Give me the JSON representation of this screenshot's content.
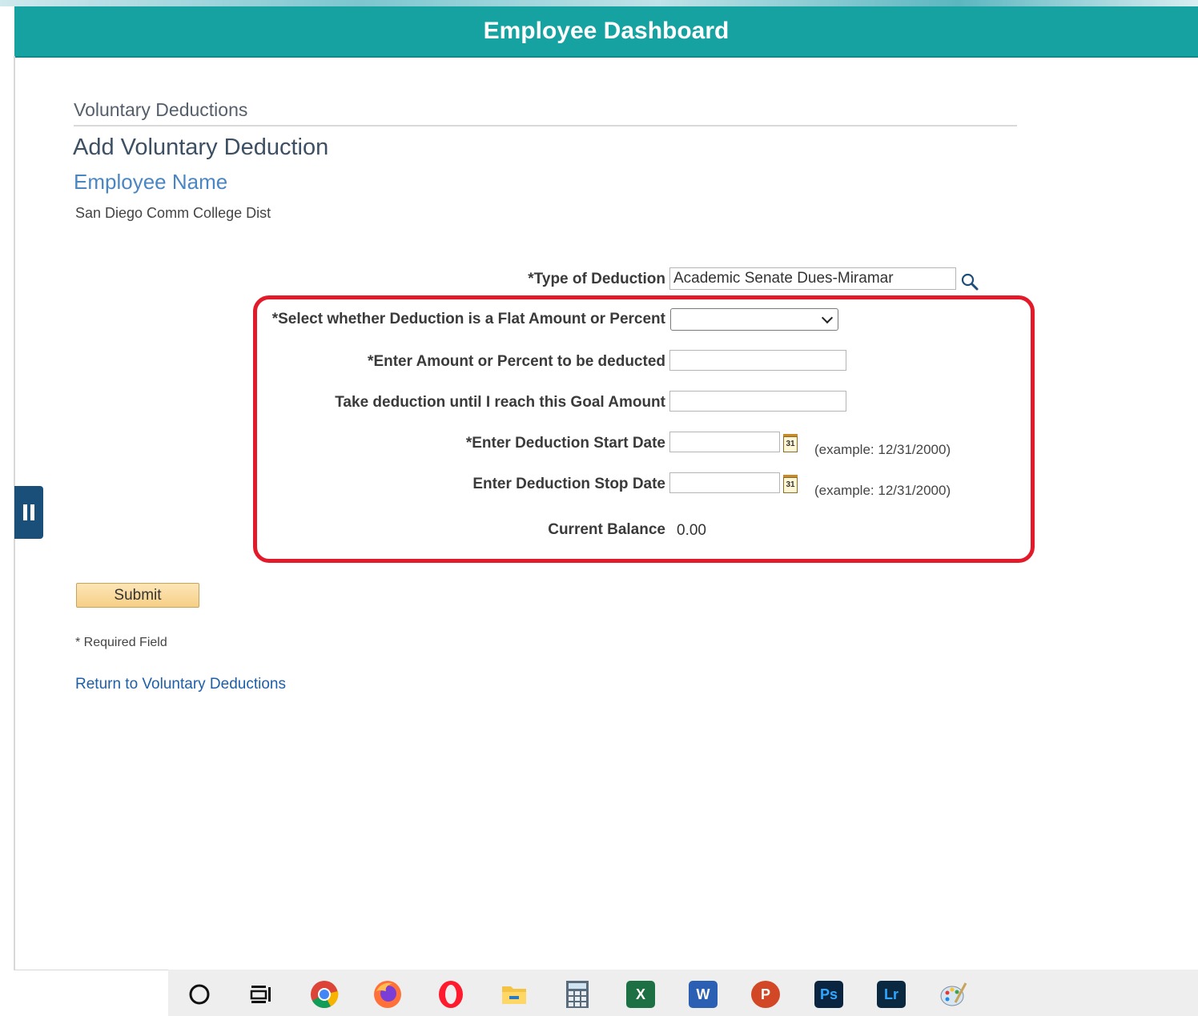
{
  "header": {
    "title": "Employee Dashboard"
  },
  "breadcrumb": "Voluntary Deductions",
  "page_title": "Add Voluntary Deduction",
  "employee_name": "Employee Name",
  "organization": "San Diego Comm College Dist",
  "form": {
    "type_label": "*Type of Deduction",
    "type_value": "Academic Senate Dues-Miramar",
    "flat_or_percent_label": "*Select whether Deduction is a Flat Amount or Percent",
    "flat_or_percent_value": "",
    "amount_label": "*Enter Amount or Percent to be deducted",
    "amount_value": "",
    "goal_label": "Take deduction until I reach this Goal Amount",
    "goal_value": "",
    "start_label": "*Enter Deduction Start Date",
    "start_value": "",
    "start_example": "(example: 12/31/2000)",
    "stop_label": "Enter Deduction Stop Date",
    "stop_value": "",
    "stop_example": "(example: 12/31/2000)",
    "balance_label": "Current Balance",
    "balance_value": "0.00",
    "calendar_glyph": "31"
  },
  "submit_label": "Submit",
  "required_note": "* Required Field",
  "return_link": "Return to Voluntary Deductions",
  "colors": {
    "header_bg": "#17a2a2",
    "highlight": "#e21a2a",
    "link": "#1f5fa8"
  },
  "taskbar": {
    "icons": [
      "cortana-circle-icon",
      "task-view-icon",
      "chrome-icon",
      "firefox-icon",
      "opera-icon",
      "file-explorer-icon",
      "calculator-icon",
      "excel-icon",
      "word-icon",
      "powerpoint-icon",
      "photoshop-icon",
      "lightroom-icon",
      "paint-icon"
    ],
    "excel_letter": "X",
    "word_letter": "W",
    "powerpoint_letter": "P",
    "photoshop_letters": "Ps",
    "lightroom_letters": "Lr"
  }
}
